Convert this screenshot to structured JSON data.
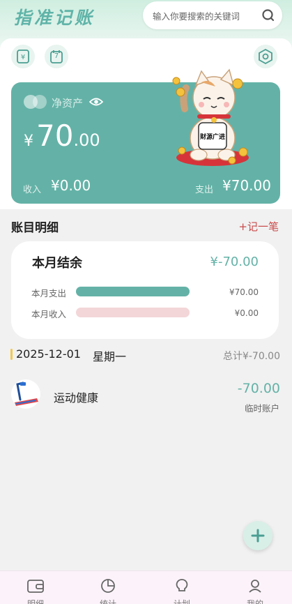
{
  "app": {
    "title": "指准记账"
  },
  "search": {
    "placeholder": "输入你要搜索的关键词"
  },
  "toolbar": {
    "calendar_day": "7"
  },
  "assets": {
    "label": "净资产",
    "currency": "¥",
    "value_int": "70",
    "value_dec": ".00",
    "income_label": "收入",
    "income_value": "¥0.00",
    "expense_label": "支出",
    "expense_value": "¥70.00"
  },
  "mascot": {
    "sign_text": "财源广进"
  },
  "details": {
    "title": "账目明细",
    "add_label": "+记一笔"
  },
  "month": {
    "title": "本月结余",
    "balance": "¥-70.00",
    "expense_label": "本月支出",
    "expense_value": "¥70.00",
    "expense_fraction": 1,
    "income_label": "本月收入",
    "income_value": "¥0.00",
    "income_fraction": 0
  },
  "day": {
    "date": "2025-12-01",
    "weekday": "星期一",
    "total": "总计¥-70.00"
  },
  "entries": [
    {
      "name": "运动健康",
      "amount": "-70.00",
      "account": "临时账户",
      "icon": "treadmill-icon"
    }
  ],
  "tabs": [
    {
      "label": "明细",
      "icon": "wallet-icon"
    },
    {
      "label": "统计",
      "icon": "pie-chart-icon"
    },
    {
      "label": "计划",
      "icon": "lightbulb-icon"
    },
    {
      "label": "我的",
      "icon": "user-icon"
    }
  ],
  "colors": {
    "accent": "#64b2a7",
    "expense_bar": "#64b2a7",
    "income_bar": "#f3d6d8",
    "add_record": "#c94a4a"
  }
}
